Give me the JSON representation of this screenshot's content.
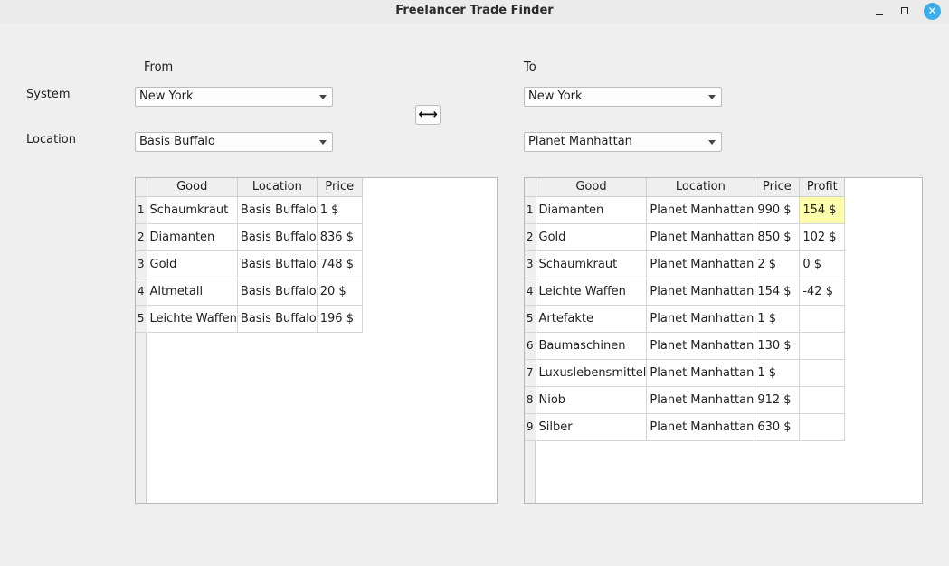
{
  "window": {
    "title": "Freelancer Trade Finder",
    "close_glyph": "✕"
  },
  "labels": {
    "from": "From",
    "to": "To",
    "system": "System",
    "location": "Location"
  },
  "from": {
    "system": "New York",
    "location": "Basis Buffalo"
  },
  "to": {
    "system": "New York",
    "location": "Planet Manhattan"
  },
  "swap_button": {
    "icon": "swap-arrows-icon",
    "glyph": "⟷"
  },
  "from_table": {
    "headers": [
      "Good",
      "Location",
      "Price"
    ],
    "rows": [
      {
        "n": "1",
        "good": "Schaumkraut",
        "location": "Basis Buffalo",
        "price": "1 $"
      },
      {
        "n": "2",
        "good": "Diamanten",
        "location": "Basis Buffalo",
        "price": "836 $"
      },
      {
        "n": "3",
        "good": "Gold",
        "location": "Basis Buffalo",
        "price": "748 $"
      },
      {
        "n": "4",
        "good": "Altmetall",
        "location": "Basis Buffalo",
        "price": "20 $"
      },
      {
        "n": "5",
        "good": "Leichte Waffen",
        "location": "Basis Buffalo",
        "price": "196 $"
      }
    ]
  },
  "to_table": {
    "headers": [
      "Good",
      "Location",
      "Price",
      "Profit"
    ],
    "highlight_color": "#fdfdab",
    "rows": [
      {
        "n": "1",
        "good": "Diamanten",
        "location": "Planet Manhattan",
        "price": "990 $",
        "profit": "154 $"
      },
      {
        "n": "2",
        "good": "Gold",
        "location": "Planet Manhattan",
        "price": "850 $",
        "profit": "102 $"
      },
      {
        "n": "3",
        "good": "Schaumkraut",
        "location": "Planet Manhattan",
        "price": "2 $",
        "profit": "0 $"
      },
      {
        "n": "4",
        "good": "Leichte Waffen",
        "location": "Planet Manhattan",
        "price": "154 $",
        "profit": "-42 $"
      },
      {
        "n": "5",
        "good": "Artefakte",
        "location": "Planet Manhattan",
        "price": "1 $",
        "profit": ""
      },
      {
        "n": "6",
        "good": "Baumaschinen",
        "location": "Planet Manhattan",
        "price": "130 $",
        "profit": ""
      },
      {
        "n": "7",
        "good": "Luxuslebensmittel",
        "location": "Planet Manhattan",
        "price": "1 $",
        "profit": ""
      },
      {
        "n": "8",
        "good": "Niob",
        "location": "Planet Manhattan",
        "price": "912 $",
        "profit": ""
      },
      {
        "n": "9",
        "good": "Silber",
        "location": "Planet Manhattan",
        "price": "630 $",
        "profit": ""
      }
    ]
  }
}
